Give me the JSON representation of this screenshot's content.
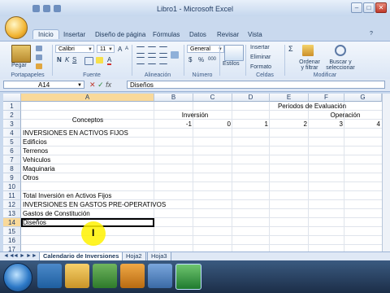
{
  "window": {
    "title": "Libro1 - Microsoft Excel",
    "controls": {
      "minimize": "–",
      "maximize": "□",
      "close": "✕"
    }
  },
  "ribbon": {
    "tabs": [
      "Inicio",
      "Insertar",
      "Diseño de página",
      "Fórmulas",
      "Datos",
      "Revisar",
      "Vista"
    ],
    "active_tab": "Inicio",
    "clipboard": {
      "paste_label": "Pegar",
      "group_label": "Portapapeles"
    },
    "font": {
      "name": "Calibri",
      "size": "11",
      "bold": "N",
      "italic": "K",
      "underline": "S",
      "grow": "A",
      "shrink": "A",
      "color": "A",
      "group_label": "Fuente"
    },
    "alignment": {
      "group_label": "Alineación"
    },
    "number": {
      "format": "General",
      "currency": "$",
      "percent": "%",
      "thousands": "000",
      "group_label": "Número"
    },
    "styles": {
      "label": "Estilos"
    },
    "cells": {
      "insert": "Insertar",
      "delete": "Eliminar",
      "format": "Formato",
      "group_label": "Celdas"
    },
    "editing": {
      "sum": "Σ",
      "sort_label": "Ordenar y filtrar",
      "find_label": "Buscar y seleccionar",
      "group_label": "Modificar"
    }
  },
  "formula_bar": {
    "name_box": "A14",
    "fx_label": "fx",
    "content": "Diseños"
  },
  "sheet": {
    "columns": [
      "A",
      "B",
      "C",
      "D",
      "E",
      "F",
      "G"
    ],
    "rows": [
      "1",
      "2",
      "3",
      "4",
      "5",
      "6",
      "7",
      "8",
      "9",
      "10",
      "11",
      "12",
      "13",
      "14",
      "15",
      "16",
      "17"
    ],
    "active_cell": "A14",
    "cells": {
      "A3": "Conceptos",
      "E2": "Periodos de Evaluación",
      "B3": "Inversión",
      "F3": "Operación",
      "B4": "-1",
      "C4": "0",
      "D4": "1",
      "E4": "2",
      "F4": "3",
      "G4": "4",
      "A5": "INVERSIONES EN ACTIVOS FIJOS",
      "A6": "Edificios",
      "A7": "Terrenos",
      "A8": "Vehiculos",
      "A9": "Maquinaria",
      "A10": "Otros",
      "A12": "Total Inversión en Activos Fijos",
      "A13": "INVERSIONES EN GASTOS PRE-OPERATIVOS",
      "A14": "Gastos de Constitución",
      "A15": "Diseños"
    }
  },
  "sheet_tabs": [
    "Calendario de Inversiones",
    "Hoja2",
    "Hoja3"
  ],
  "active_sheet": "Calendario de Inversiones",
  "sheet_nav": [
    "◄◄",
    "◄",
    "►",
    "►►"
  ],
  "colors": {
    "ribbon": "#dbe6f5",
    "accent": "#2b579a",
    "highlight": "#f9d99a"
  }
}
